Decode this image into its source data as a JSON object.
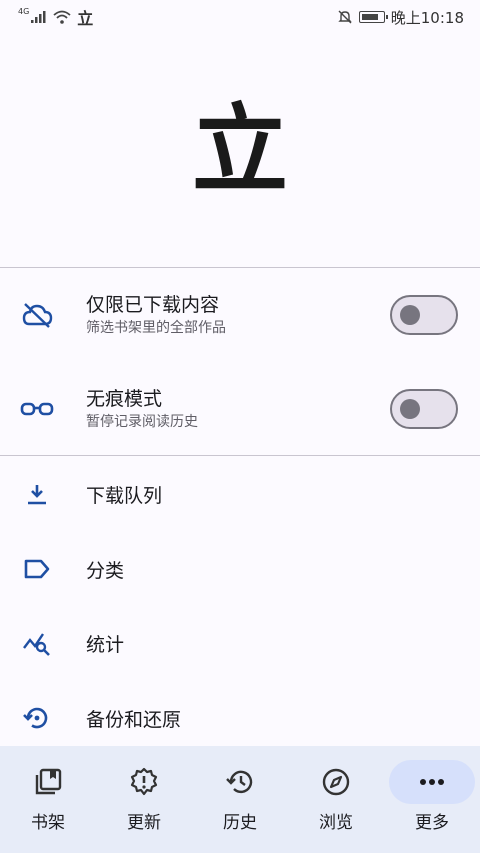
{
  "status_bar": {
    "network": "4G",
    "app_glyph": "立",
    "time": "晚上10:18",
    "icons": [
      "signal-icon",
      "wifi-icon",
      "bell-off-icon",
      "battery-icon"
    ]
  },
  "header": {
    "logo_text": "立"
  },
  "toggles": [
    {
      "title": "仅限已下载内容",
      "subtitle": "筛选书架里的全部作品",
      "icon": "cloud-off-icon",
      "on": false
    },
    {
      "title": "无痕模式",
      "subtitle": "暂停记录阅读历史",
      "icon": "glasses-icon",
      "on": false
    }
  ],
  "menu": [
    {
      "label": "下载队列",
      "icon": "download-icon"
    },
    {
      "label": "分类",
      "icon": "label-icon"
    },
    {
      "label": "统计",
      "icon": "stats-icon"
    },
    {
      "label": "备份和还原",
      "icon": "restore-icon"
    }
  ],
  "bottom_nav": [
    {
      "label": "书架",
      "icon": "library-icon",
      "active": false
    },
    {
      "label": "更新",
      "icon": "updates-icon",
      "active": false
    },
    {
      "label": "历史",
      "icon": "history-icon",
      "active": false
    },
    {
      "label": "浏览",
      "icon": "compass-icon",
      "active": false
    },
    {
      "label": "更多",
      "icon": "more-icon",
      "active": true
    }
  ],
  "colors": {
    "accent": "#1f4fa3",
    "nav_bg": "#e7ecf8",
    "nav_active": "#d6e0fb",
    "background": "#fcfaff"
  }
}
